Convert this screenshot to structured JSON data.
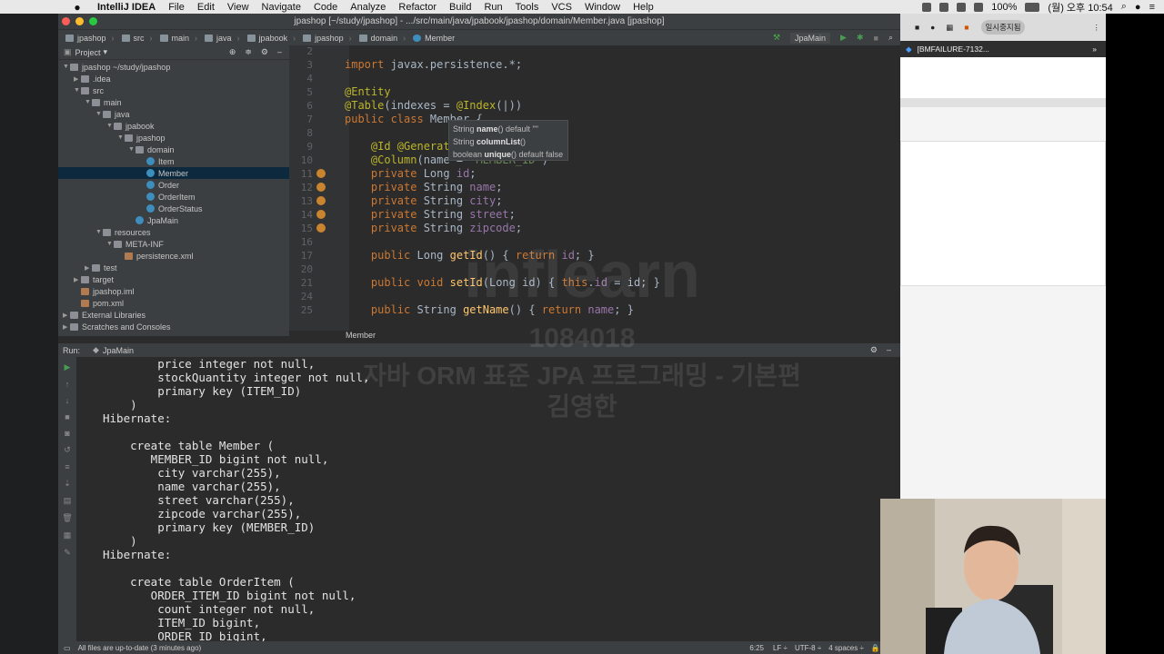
{
  "menubar": {
    "app": "IntelliJ IDEA",
    "items": [
      "File",
      "Edit",
      "View",
      "Navigate",
      "Code",
      "Analyze",
      "Refactor",
      "Build",
      "Run",
      "Tools",
      "VCS",
      "Window",
      "Help"
    ],
    "battery": "100%",
    "datetime": "(월) 오후 10:54"
  },
  "ide": {
    "title": "jpashop [~/study/jpashop] - .../src/main/java/jpabook/jpashop/domain/Member.java [jpashop]",
    "breadcrumbs": [
      "jpashop",
      "src",
      "main",
      "java",
      "jpabook",
      "jpashop",
      "domain",
      "Member"
    ],
    "run_config": "JpaMain",
    "project_label": "Project",
    "tree": [
      {
        "label": "jpashop  ~/study/jpashop",
        "depth": 0,
        "open": true,
        "type": "folder"
      },
      {
        "label": ".idea",
        "depth": 1,
        "open": false,
        "type": "folder"
      },
      {
        "label": "src",
        "depth": 1,
        "open": true,
        "type": "folder"
      },
      {
        "label": "main",
        "depth": 2,
        "open": true,
        "type": "folder"
      },
      {
        "label": "java",
        "depth": 3,
        "open": true,
        "type": "folder"
      },
      {
        "label": "jpabook",
        "depth": 4,
        "open": true,
        "type": "folder"
      },
      {
        "label": "jpashop",
        "depth": 5,
        "open": true,
        "type": "folder"
      },
      {
        "label": "domain",
        "depth": 6,
        "open": true,
        "type": "folder"
      },
      {
        "label": "Item",
        "depth": 7,
        "type": "class"
      },
      {
        "label": "Member",
        "depth": 7,
        "type": "class",
        "selected": true
      },
      {
        "label": "Order",
        "depth": 7,
        "type": "class"
      },
      {
        "label": "OrderItem",
        "depth": 7,
        "type": "class"
      },
      {
        "label": "OrderStatus",
        "depth": 7,
        "type": "class"
      },
      {
        "label": "JpaMain",
        "depth": 6,
        "type": "class"
      },
      {
        "label": "resources",
        "depth": 3,
        "open": true,
        "type": "folder"
      },
      {
        "label": "META-INF",
        "depth": 4,
        "open": true,
        "type": "folder"
      },
      {
        "label": "persistence.xml",
        "depth": 5,
        "type": "file"
      },
      {
        "label": "test",
        "depth": 2,
        "open": false,
        "type": "folder"
      },
      {
        "label": "target",
        "depth": 1,
        "open": false,
        "type": "folder"
      },
      {
        "label": "jpashop.iml",
        "depth": 1,
        "type": "file"
      },
      {
        "label": "pom.xml",
        "depth": 1,
        "type": "file"
      },
      {
        "label": "External Libraries",
        "depth": 0,
        "open": false,
        "type": "folder"
      },
      {
        "label": "Scratches and Consoles",
        "depth": 0,
        "open": false,
        "type": "folder"
      }
    ],
    "editor_lines": [
      {
        "n": "2",
        "html": ""
      },
      {
        "n": "3",
        "html": "<span class='kw'>import</span> javax.persistence.*;"
      },
      {
        "n": "4",
        "html": ""
      },
      {
        "n": "5",
        "html": "<span class='an'>@Entity</span>"
      },
      {
        "n": "6",
        "html": "<span class='an'>@Table</span>(indexes = <span class='an'>@Index</span>(|))"
      },
      {
        "n": "7",
        "html": "<span class='kw'>public class</span> Member {"
      },
      {
        "n": "8",
        "html": ""
      },
      {
        "n": "9",
        "html": "    <span class='an'>@Id @GeneratedValue</span>"
      },
      {
        "n": "10",
        "html": "    <span class='an'>@Column</span>(name = <span style='color:#6a8759'>\"MEMBER_ID\"</span>)"
      },
      {
        "n": "11",
        "html": "    <span class='kw'>private</span> Long <span class='fld'>id</span>;"
      },
      {
        "n": "12",
        "html": "    <span class='kw'>private</span> String <span class='fld'>name</span>;"
      },
      {
        "n": "13",
        "html": "    <span class='kw'>private</span> String <span class='fld'>city</span>;"
      },
      {
        "n": "14",
        "html": "    <span class='kw'>private</span> String <span class='fld'>street</span>;"
      },
      {
        "n": "15",
        "html": "    <span class='kw'>private</span> String <span class='fld'>zipcode</span>;"
      },
      {
        "n": "16",
        "html": ""
      },
      {
        "n": "17",
        "html": "    <span class='kw'>public</span> Long <span class='fn'>getId</span>() { <span class='kw'>return</span> <span class='fld'>id</span>; }"
      },
      {
        "n": "20",
        "html": ""
      },
      {
        "n": "21",
        "html": "    <span class='kw'>public void</span> <span class='fn'>setId</span>(Long id) { <span class='kw'>this</span>.<span class='fld'>id</span> = id; }"
      },
      {
        "n": "24",
        "html": ""
      },
      {
        "n": "25",
        "html": "    <span class='kw'>public</span> String <span class='fn'>getName</span>() { <span class='kw'>return</span> <span class='fld'>name</span>; }"
      }
    ],
    "popup": [
      {
        "type": "String",
        "name": "name",
        "rest": "() default \"\""
      },
      {
        "type": "String",
        "name": "columnList",
        "rest": "()"
      },
      {
        "type": "boolean",
        "name": "unique",
        "rest": "() default false"
      }
    ],
    "editor_footer": "Member",
    "run_label": "Run:",
    "run_tab": "JpaMain",
    "console_lines": [
      "        price integer not null,",
      "        stockQuantity integer not null,",
      "        primary key (ITEM_ID)",
      "    )",
      "Hibernate: ",
      "",
      "    create table Member (",
      "       MEMBER_ID bigint not null,",
      "        city varchar(255),",
      "        name varchar(255),",
      "        street varchar(255),",
      "        zipcode varchar(255),",
      "        primary key (MEMBER_ID)",
      "    )",
      "Hibernate: ",
      "",
      "    create table OrderItem (",
      "       ORDER_ITEM_ID bigint not null,",
      "        count integer not null,",
      "        ITEM_ID bigint,",
      "        ORDER_ID bigint,"
    ],
    "status": {
      "message": "All files are up-to-date (3 minutes ago)",
      "position": "6:25",
      "line_sep": "LF ÷",
      "encoding": "UTF-8 ÷",
      "indent": "4 spaces ÷"
    }
  },
  "browser": {
    "bookmark": "일시중지됨",
    "tab": "[BMFAILURE-7132..."
  },
  "watermark": {
    "brand": "inflearn",
    "code": "1084018",
    "course": "자바 ORM 표준 JPA 프로그래밍 - 기본편",
    "author": "김영한"
  }
}
